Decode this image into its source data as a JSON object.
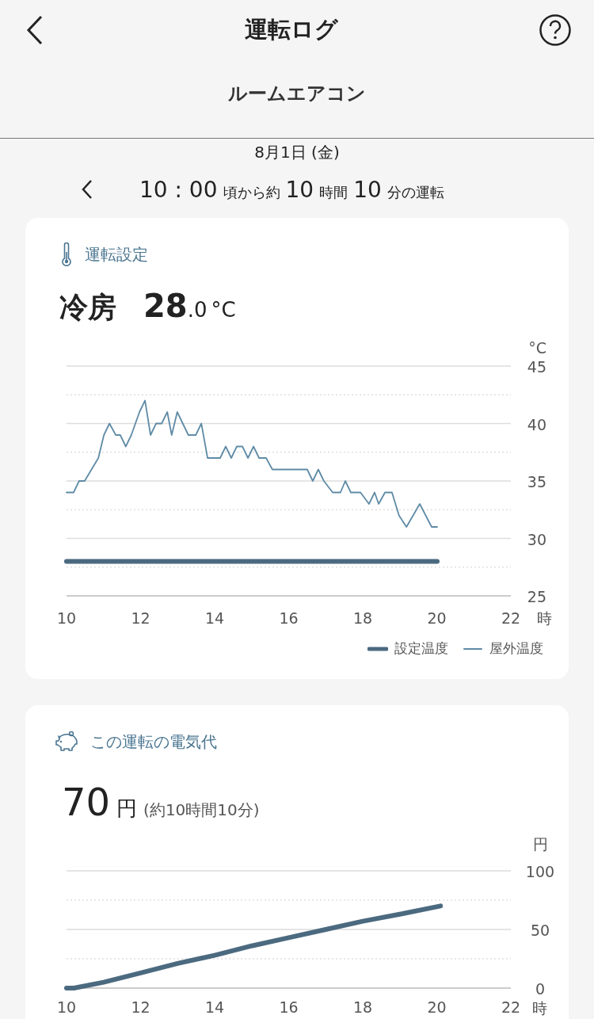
{
  "header": {
    "title": "運転ログ"
  },
  "device": {
    "name": "ルームエアコン"
  },
  "date": "8月1日 (金)",
  "session": {
    "parts": [
      {
        "kind": "big",
        "text": "10 : 00"
      },
      {
        "kind": "small",
        "text": "頃から約"
      },
      {
        "kind": "big",
        "text": "10"
      },
      {
        "kind": "small",
        "text": "時間"
      },
      {
        "kind": "big",
        "text": "10"
      },
      {
        "kind": "small",
        "text": "分の運転"
      }
    ]
  },
  "setting_card": {
    "title": "運転設定",
    "mode": "冷房",
    "temp_int": "28",
    "temp_dec": ".0",
    "temp_unit": "°C",
    "chart_data": {
      "type": "line",
      "grid": true,
      "xlabel": "時",
      "ylabel": "°C",
      "xlim": [
        10,
        22
      ],
      "ylim": [
        25,
        45
      ],
      "xticks": [
        10,
        12,
        14,
        16,
        18,
        20,
        22
      ],
      "yticks": [
        25,
        30,
        35,
        40,
        45
      ],
      "ref_lines": [
        {
          "axis": "y",
          "value": 27.5
        },
        {
          "axis": "y",
          "value": 32.5
        },
        {
          "axis": "y",
          "value": 37.5
        },
        {
          "axis": "y",
          "value": 42.5
        }
      ],
      "x": [
        10,
        10.19,
        10.34,
        10.49,
        10.86,
        11.01,
        11.16,
        11.33,
        11.45,
        11.6,
        11.75,
        11.97,
        12.12,
        12.27,
        12.42,
        12.57,
        12.72,
        12.84,
        12.99,
        13.29,
        13.49,
        13.64,
        13.81,
        14,
        14.15,
        14.3,
        14.45,
        14.6,
        14.75,
        14.9,
        15.05,
        15.2,
        15.39,
        15.56,
        15.82,
        16.5,
        16.65,
        16.8,
        16.95,
        17.19,
        17.4,
        17.53,
        17.68,
        17.94,
        18.17,
        18.32,
        18.43,
        18.6,
        18.79,
        18.98,
        19.18,
        19.54,
        19.86,
        20.01
      ],
      "series": [
        {
          "name": "設定温度",
          "color": "#4b6a80",
          "values": [
            28,
            28,
            28,
            28,
            28,
            28,
            28,
            28,
            28,
            28,
            28,
            28,
            28,
            28,
            28,
            28,
            28,
            28,
            28,
            28,
            28,
            28,
            28,
            28,
            28,
            28,
            28,
            28,
            28,
            28,
            28,
            28,
            28,
            28,
            28,
            28,
            28,
            28,
            28,
            28,
            28,
            28,
            28,
            28,
            28,
            28,
            28,
            28,
            28,
            28,
            28,
            28,
            28,
            28
          ]
        },
        {
          "name": "屋外温度",
          "color": "#5f8ba6",
          "values": [
            34,
            34,
            35,
            35,
            37,
            39,
            40,
            39,
            39,
            38,
            39,
            41,
            42,
            39,
            40,
            40,
            41,
            39,
            41,
            39,
            39,
            40,
            37,
            37,
            37,
            38,
            37,
            38,
            38,
            37,
            38,
            37,
            37,
            36,
            36,
            36,
            35,
            36,
            35,
            34,
            34,
            35,
            34,
            34,
            33,
            34,
            33,
            34,
            34,
            32,
            31,
            33,
            31,
            31
          ]
        }
      ]
    }
  },
  "cost_card": {
    "title": "この運転の電気代",
    "amount": "70",
    "unit": "円",
    "duration": "(約10時間10分)",
    "chart_data": {
      "type": "line",
      "grid": true,
      "xlabel": "時",
      "ylabel": "円",
      "xlim": [
        10,
        22
      ],
      "ylim": [
        0,
        100
      ],
      "xticks": [
        10,
        12,
        14,
        16,
        18,
        20,
        22
      ],
      "yticks": [
        0,
        50,
        100
      ],
      "ref_lines": [
        {
          "axis": "y",
          "value": 25
        },
        {
          "axis": "y",
          "value": 75
        }
      ],
      "x": [
        10,
        10.2,
        11,
        12,
        13,
        14,
        15,
        16,
        17,
        18,
        19,
        20.1
      ],
      "series": [
        {
          "color": "#4b6a80",
          "values": [
            0,
            0,
            5,
            13,
            21,
            28,
            36,
            43,
            50,
            57,
            63,
            70
          ]
        }
      ]
    }
  }
}
